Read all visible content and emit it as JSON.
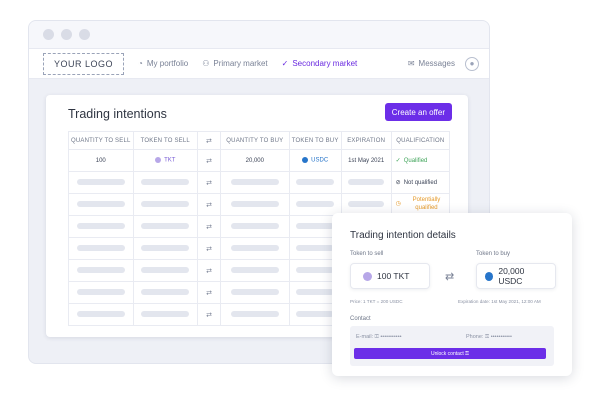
{
  "window": {
    "controls": [
      "",
      "",
      ""
    ]
  },
  "nav": {
    "logo": "YOUR LOGO",
    "items": [
      {
        "label": "My portfolio",
        "icon": "pie-chart-icon",
        "active": false
      },
      {
        "label": "Primary market",
        "icon": "people-icon",
        "active": false
      },
      {
        "label": "Secondary market",
        "icon": "check-circle-icon",
        "active": true
      }
    ],
    "messages": "Messages",
    "accent": "#6a2be0"
  },
  "trading": {
    "title": "Trading intentions",
    "create_button": "Create an offer",
    "columns": [
      "QUANTITY TO SELL",
      "TOKEN TO SELL",
      "",
      "QUANTITY TO BUY",
      "TOKEN TO BUY",
      "EXPIRATION",
      "QUALIFICATION"
    ],
    "first_row": {
      "qty_sell": "100",
      "token_sell": "TKT",
      "qty_buy": "20,000",
      "token_buy": "USDC",
      "expiration": "1st May 2021",
      "qualification": "Qualified"
    },
    "qualifications": [
      "Not qualified",
      "Potentially qualified"
    ],
    "status_colors": {
      "qualified": "#3fa45a",
      "potential": "#e59a2a"
    }
  },
  "details": {
    "title": "Trading intention details",
    "sell_label": "Token to sell",
    "buy_label": "Token to buy",
    "sell_value": "100 TKT",
    "buy_value": "20,000 USDC",
    "price_note": "Price: 1 TKT = 200 USDC",
    "expiration_note": "Expiration date: 1st May 2021, 12:00 AM",
    "contact_label": "Contact",
    "email_label": "E-mail:",
    "email_value": "•••••••••••",
    "phone_label": "Phone:",
    "phone_value": "•••••••••••",
    "unlock_button": "Unlock contact"
  }
}
